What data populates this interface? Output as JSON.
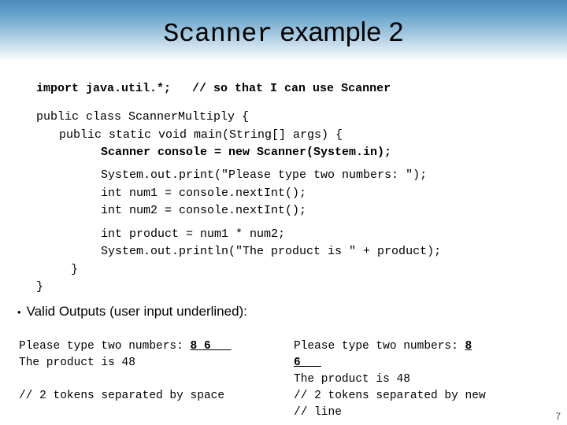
{
  "slide": {
    "title_mono": "Scanner",
    "title_sans": " example 2",
    "page_number": "7",
    "code": {
      "import_line": "import java.util.*;   // so that I can use Scanner",
      "class_line": "public class ScannerMultiply {",
      "main_line": "public static void main(String[] args) {",
      "scanner_line": "Scanner console = new Scanner(System.in);",
      "print_line": "System.out.print(\"Please type two numbers: \");",
      "num1_line": "int num1 = console.nextInt();",
      "num2_line": "int num2 = console.nextInt();",
      "product_line": "int product = num1 * num2;",
      "println_line": "System.out.println(\"The product is \" + product);",
      "close_brace_inner": "}",
      "close_brace_outer": "}"
    },
    "bullet": {
      "marker": "•",
      "text": "Valid Outputs (user input underlined):"
    },
    "output_left": {
      "line1_prompt": "Please type two numbers: ",
      "line1_input": "8 6",
      "line1_trail": "   ",
      "line2": "The product is 48",
      "line3": "",
      "line4": "// 2 tokens separated by space"
    },
    "output_right": {
      "line1_prompt": "Please type two numbers: ",
      "line1_input": "8",
      "line2_input": "6",
      "line2_trail": "   ",
      "line3": "The product is 48",
      "line4": "// 2 tokens separated by new",
      "line5": "// line"
    }
  }
}
